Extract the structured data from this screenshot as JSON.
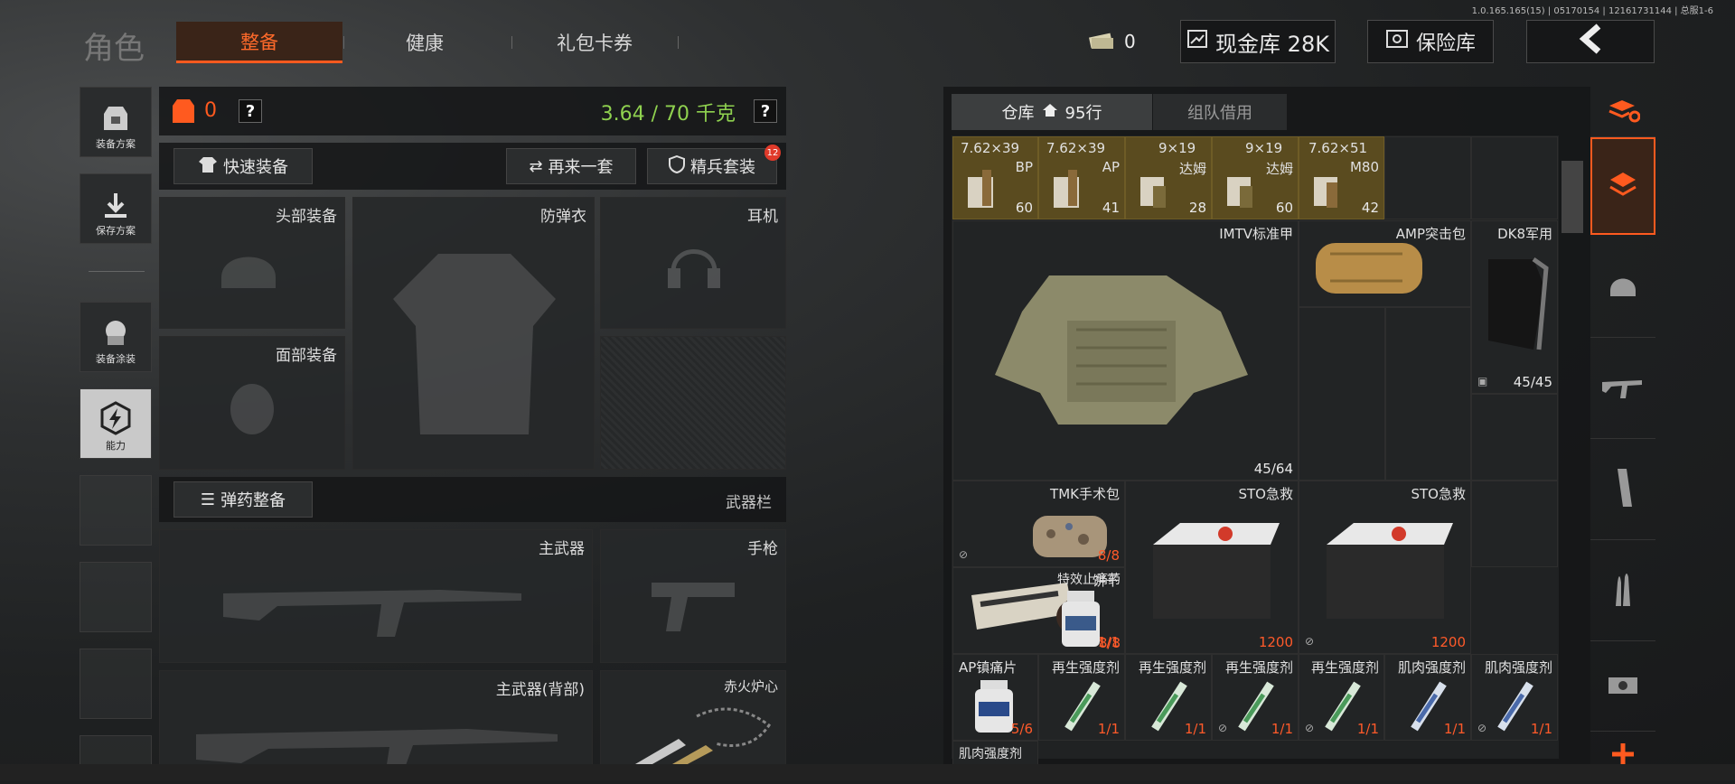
{
  "version": "1.0.165.165(15) | 05170154 | 12161731144 | 总服1-6",
  "title": "角色",
  "tabs": [
    {
      "label": "整备",
      "active": true
    },
    {
      "label": "健康"
    },
    {
      "label": "礼包卡券"
    }
  ],
  "header": {
    "cash_count": "0",
    "cash_warehouse": "现金库 28K",
    "insurance": "保险库"
  },
  "left_nav": [
    {
      "label": "装备方案"
    },
    {
      "label": "保存方案"
    },
    {
      "label": "装备涂装"
    },
    {
      "label": "能力"
    }
  ],
  "loadout": {
    "armor_value": "0",
    "weight": "3.64 / 70 千克",
    "quick_equip": "快速装备",
    "again": "再来一套",
    "elite": "精兵套装",
    "elite_badge": "12",
    "slots": {
      "head": "头部装备",
      "vest": "防弹衣",
      "headset": "耳机",
      "face": "面部装备"
    },
    "ammo_btn": "弹药整备",
    "weapon_bar": "武器栏",
    "weapons": {
      "primary": "主武器",
      "pistol": "手枪",
      "primary_back": "主武器(背部)",
      "melee": "赤火炉心"
    }
  },
  "warehouse": {
    "tab_label": "仓库",
    "rows": "95行",
    "team_tab": "组队借用",
    "ammo": [
      {
        "name": "7.62×39",
        "sub": "BP",
        "count": "60"
      },
      {
        "name": "7.62×39",
        "sub": "AP",
        "count": "41"
      },
      {
        "name": "9×19",
        "sub": "达姆",
        "count": "28"
      },
      {
        "name": "9×19",
        "sub": "达姆",
        "count": "60"
      },
      {
        "name": "7.62×51",
        "sub": "M80",
        "count": "42"
      }
    ],
    "items": {
      "imtv": {
        "name": "IMTV标准甲",
        "count": "45/64"
      },
      "amp": {
        "name": "AMP突击包"
      },
      "dk8": {
        "name": "DK8军用",
        "count": "45/45"
      },
      "tmk": {
        "name": "TMK手术包",
        "count": "8/8"
      },
      "sto1": {
        "name": "STO急救",
        "count": "1200"
      },
      "sto2": {
        "name": "STO急救",
        "count": "1200"
      },
      "biscuit": {
        "name": "饼干",
        "count": "1/1"
      },
      "painkiller": {
        "name": "特效止痛药",
        "count": "8/8"
      },
      "ap_pill": {
        "name": "AP镇痛片",
        "count": "5/6"
      },
      "regen": [
        {
          "name": "再生强度剂",
          "count": "1/1"
        },
        {
          "name": "再生强度剂",
          "count": "1/1"
        },
        {
          "name": "再生强度剂",
          "count": "1/1"
        },
        {
          "name": "再生强度剂",
          "count": "1/1"
        }
      ],
      "muscle": [
        {
          "name": "肌肉强度剂",
          "count": "1/1"
        },
        {
          "name": "肌肉强度剂",
          "count": "1/1"
        }
      ],
      "muscle_bottom": "肌肉强度剂"
    }
  },
  "colors": {
    "accent": "#ff5a1f",
    "weight_green": "#8fd14f",
    "gold": "#5a4b1f"
  }
}
